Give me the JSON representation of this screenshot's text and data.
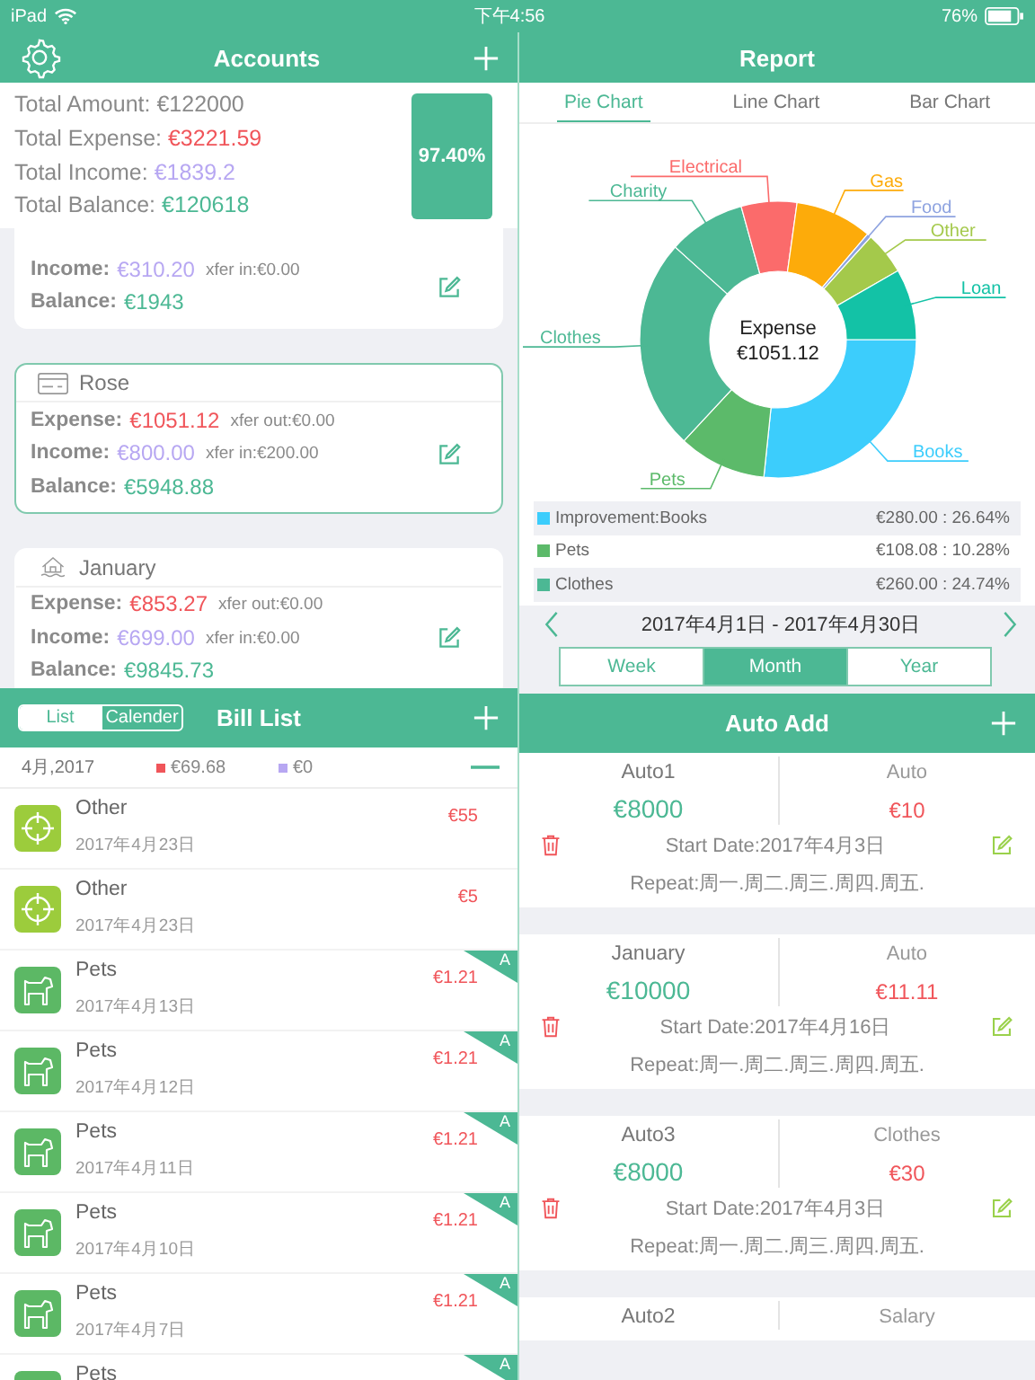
{
  "status_bar": {
    "device": "iPad",
    "time": "下午4:56",
    "battery_text": "76%"
  },
  "accounts": {
    "title": "Accounts",
    "summary": [
      {
        "label": "Total Amount: ",
        "value": "€122000",
        "kind": "amount"
      },
      {
        "label": "Total Expense: ",
        "value": "€3221.59",
        "kind": "expense"
      },
      {
        "label": "Total Income: ",
        "value": "€1839.2",
        "kind": "income"
      },
      {
        "label": "Total Balance: ",
        "value": "€120618",
        "kind": "balance"
      }
    ],
    "percent": "97.40%",
    "cards": [
      {
        "selected": false,
        "lines": [
          {
            "label": "Income:",
            "value": "€310.20",
            "kind": "income",
            "note": "xfer in:€0.00"
          },
          {
            "label": "Balance:",
            "value": "€1943",
            "kind": "balance"
          }
        ]
      },
      {
        "name": "Rose",
        "kind": "card",
        "selected": true,
        "lines": [
          {
            "label": "Expense:",
            "value": "€1051.12",
            "kind": "expense",
            "note": "xfer out:€0.00"
          },
          {
            "label": "Income:",
            "value": "€800.00",
            "kind": "income",
            "note": "xfer in:€200.00"
          },
          {
            "label": "Balance:",
            "value": "€5948.88",
            "kind": "balance"
          }
        ]
      },
      {
        "name": "January",
        "kind": "house",
        "selected": false,
        "lines": [
          {
            "label": "Expense:",
            "value": "€853.27",
            "kind": "expense",
            "note": "xfer out:€0.00"
          },
          {
            "label": "Income:",
            "value": "€699.00",
            "kind": "income",
            "note": "xfer in:€0.00"
          },
          {
            "label": "Balance:",
            "value": "€9845.73",
            "kind": "balance"
          }
        ]
      }
    ]
  },
  "bill_list": {
    "title": "Bill List",
    "tabs": [
      {
        "label": "List",
        "selected": true
      },
      {
        "label": "Calender",
        "selected": false
      }
    ],
    "month": "4月,2017",
    "expense": "€69.68",
    "income": "€0",
    "rows": [
      {
        "name": "Other",
        "date": "2017年4月23日",
        "amount": "€55",
        "kind": "target"
      },
      {
        "name": "Other",
        "date": "2017年4月23日",
        "amount": "€5",
        "kind": "target"
      },
      {
        "name": "Pets",
        "date": "2017年4月13日",
        "amount": "€1.21",
        "kind": "dog",
        "badge": "A"
      },
      {
        "name": "Pets",
        "date": "2017年4月12日",
        "amount": "€1.21",
        "kind": "dog",
        "badge": "A"
      },
      {
        "name": "Pets",
        "date": "2017年4月11日",
        "amount": "€1.21",
        "kind": "dog",
        "badge": "A"
      },
      {
        "name": "Pets",
        "date": "2017年4月10日",
        "amount": "€1.21",
        "kind": "dog",
        "badge": "A"
      },
      {
        "name": "Pets",
        "date": "2017年4月7日",
        "amount": "€1.21",
        "kind": "dog",
        "badge": "A"
      },
      {
        "name": "Pets",
        "kind": "dog",
        "badge": "A"
      }
    ]
  },
  "report": {
    "title": "Report",
    "tabs": [
      {
        "label": "Pie Chart",
        "selected": true
      },
      {
        "label": "Line Chart",
        "selected": false
      },
      {
        "label": "Bar Chart",
        "selected": false
      }
    ],
    "center_label": "Expense",
    "center_value": "€1051.12",
    "chart_data": {
      "type": "donut",
      "categories": [
        "Books",
        "Pets",
        "Clothes",
        "Charity",
        "Electrical",
        "Gas",
        "Food",
        "Other",
        "Loan"
      ],
      "colors": [
        "#3ccdfc",
        "#5cba6a",
        "#4cb894",
        "#4cb894",
        "#fb6b6b",
        "#fdab0a",
        "#8ea3e0",
        "#a4c94b",
        "#13c2a6"
      ],
      "values": [
        26.64,
        10.28,
        24.74,
        9.04,
        6.5,
        9,
        0.5,
        5,
        8.3
      ]
    },
    "legend": [
      {
        "name": "Improvement:Books",
        "value": "€280.00 : 26.64%",
        "color": "#3ccdfc"
      },
      {
        "name": "Pets",
        "value": "€108.08 : 10.28%",
        "color": "#5cba6a"
      },
      {
        "name": "Clothes",
        "value": "€260.00 : 24.74%",
        "color": "#4cb894"
      }
    ],
    "date_range": "2017年4月1日 - 2017年4月30日",
    "periods": [
      {
        "label": "Week",
        "selected": false
      },
      {
        "label": "Month",
        "selected": true
      },
      {
        "label": "Year",
        "selected": false
      }
    ]
  },
  "auto_add": {
    "title": "Auto Add",
    "items": [
      {
        "name": "Auto1",
        "category": "Auto",
        "amount": "€8000",
        "cost": "€10",
        "start": "Start Date:2017年4月3日",
        "repeat": "Repeat:周一.周二.周三.周四.周五."
      },
      {
        "name": "January",
        "category": "Auto",
        "amount": "€10000",
        "cost": "€11.11",
        "start": "Start Date:2017年4月16日",
        "repeat": "Repeat:周一.周二.周三.周四.周五."
      },
      {
        "name": "Auto3",
        "category": "Clothes",
        "amount": "€8000",
        "cost": "€30",
        "start": "Start Date:2017年4月3日",
        "repeat": "Repeat:周一.周二.周三.周四.周五."
      },
      {
        "name": "Auto2",
        "category": "Salary"
      }
    ]
  }
}
